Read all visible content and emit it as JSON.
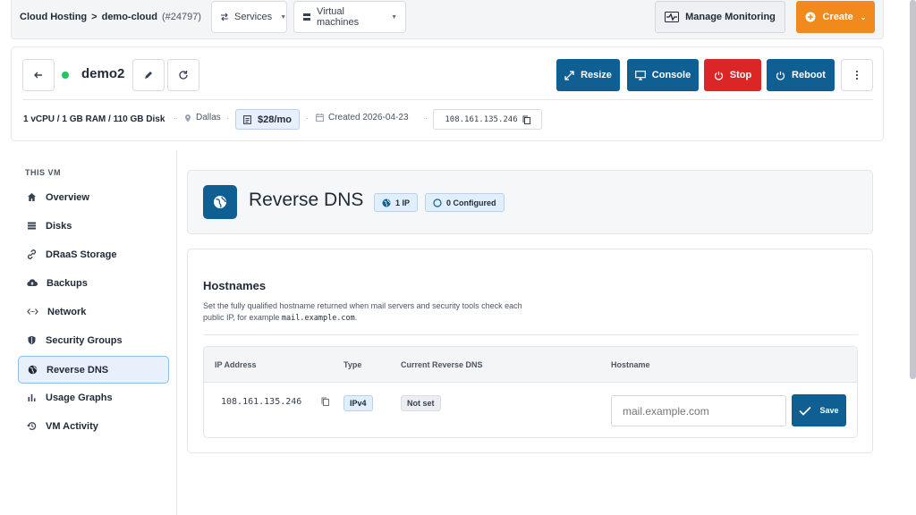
{
  "breadcrumb": {
    "root": "Cloud Hosting",
    "sep": ">",
    "project": "demo-cloud",
    "project_id": "(#24797)"
  },
  "topnav": {
    "services": "Services",
    "vms": "Virtual machines",
    "monitoring": "Manage Monitoring",
    "create": "Create"
  },
  "vm": {
    "name": "demo2",
    "status_color": "#22c55e",
    "specs": "1 vCPU / 1 GB RAM / 110 GB Disk",
    "location": "Dallas",
    "price": "$28/mo",
    "created": "Created 2026-04-23",
    "ip": "108.161.135.246",
    "actions": {
      "resize": "Resize",
      "console": "Console",
      "stop": "Stop",
      "reboot": "Reboot"
    }
  },
  "sidebar": {
    "title": "THIS VM",
    "items": [
      {
        "label": "Overview",
        "icon": "home-icon"
      },
      {
        "label": "Disks",
        "icon": "list-icon"
      },
      {
        "label": "DRaaS Storage",
        "icon": "link-icon"
      },
      {
        "label": "Backups",
        "icon": "cloud-upload-icon"
      },
      {
        "label": "Network",
        "icon": "code-arrows-icon"
      },
      {
        "label": "Security Groups",
        "icon": "shield-icon"
      },
      {
        "label": "Reverse DNS",
        "icon": "globe-icon"
      },
      {
        "label": "Usage Graphs",
        "icon": "bar-chart-icon"
      },
      {
        "label": "VM Activity",
        "icon": "history-icon"
      }
    ],
    "active": "Reverse DNS"
  },
  "page": {
    "title": "Reverse DNS",
    "ip_count": "1 IP",
    "configured": "0 Configured"
  },
  "hostnames": {
    "title": "Hostnames",
    "desc_1": "Set the fully qualified hostname returned when mail servers and security tools check each",
    "desc_2": "public IP, for example",
    "desc_code": "mail.example.com",
    "desc_end": ".",
    "columns": [
      "IP Address",
      "Type",
      "Current Reverse DNS",
      "Hostname"
    ],
    "row": {
      "ip": "108.161.135.246",
      "type": "IPv4",
      "current": "Not set",
      "placeholder": "mail.example.com",
      "save": "Save"
    }
  },
  "colors": {
    "primary": "#0f5f93",
    "danger": "#dc2626",
    "create": "#f08a1c",
    "active_bg": "#e8f1fb"
  }
}
